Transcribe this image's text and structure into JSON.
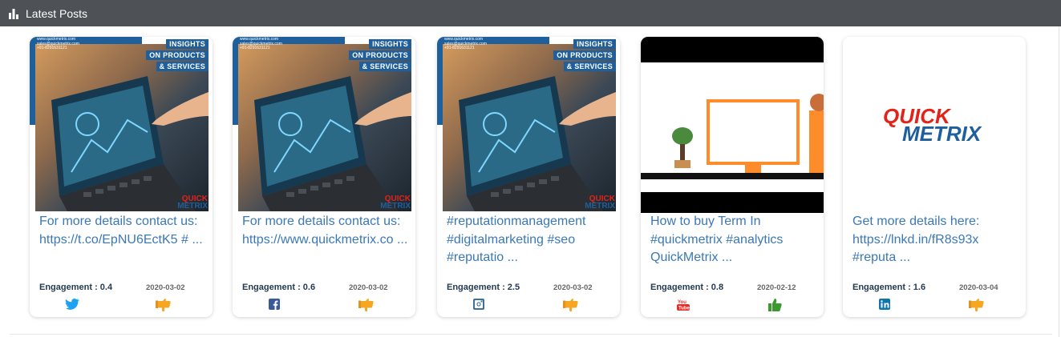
{
  "header": {
    "title": "Latest Posts",
    "icon": "bar-chart-icon"
  },
  "colors": {
    "header_bg": "#4e5155",
    "link": "#3b78b5",
    "twitter": "#1da1f2",
    "facebook": "#3b5998",
    "instagram": "#3f729b",
    "youtube": "#e52d27",
    "linkedin": "#0e76a8",
    "thumb_orange": "#f5a623",
    "thumb_green": "#3a9a2f"
  },
  "promo": {
    "contact_lines": [
      "www.quickmetrix.com",
      "sales@quickmetrix.com",
      "+91-8291631121"
    ],
    "tag_lines": [
      "INSIGHTS",
      "ON PRODUCTS",
      "& SERVICES"
    ]
  },
  "logo": {
    "line1": "QUICK",
    "line2": "METRIX"
  },
  "posts": [
    {
      "image": "promo-image",
      "caption": "For more details contact us: https://t.co/EpNU6EctK5 # ...",
      "engagement_label": "Engagement : 0.4",
      "date": "2020-03-02",
      "network": "twitter-icon",
      "reaction": "thumb-orange-icon"
    },
    {
      "image": "promo-image",
      "caption": "For more details contact us: https://www.quickmetrix.co ...",
      "engagement_label": "Engagement : 0.6",
      "date": "2020-03-02",
      "network": "facebook-icon",
      "reaction": "thumb-orange-icon"
    },
    {
      "image": "promo-image",
      "caption": "#reputationmanagement #digitalmarketing #seo #reputatio ...",
      "engagement_label": "Engagement : 2.5",
      "date": "2020-03-02",
      "network": "instagram-icon",
      "reaction": "thumb-orange-icon"
    },
    {
      "image": "video-thumbnail",
      "caption": "How to buy Term In #quickmetrix #analytics QuickMetrix ...",
      "engagement_label": "Engagement : 0.8",
      "date": "2020-02-12",
      "network": "youtube-icon",
      "reaction": "thumb-green-icon"
    },
    {
      "image": "logo-image",
      "caption": "Get more details here: https://lnkd.in/fR8s93x #reputa ...",
      "engagement_label": "Engagement : 1.6",
      "date": "2020-03-04",
      "network": "linkedin-icon",
      "reaction": "thumb-orange-icon"
    }
  ]
}
